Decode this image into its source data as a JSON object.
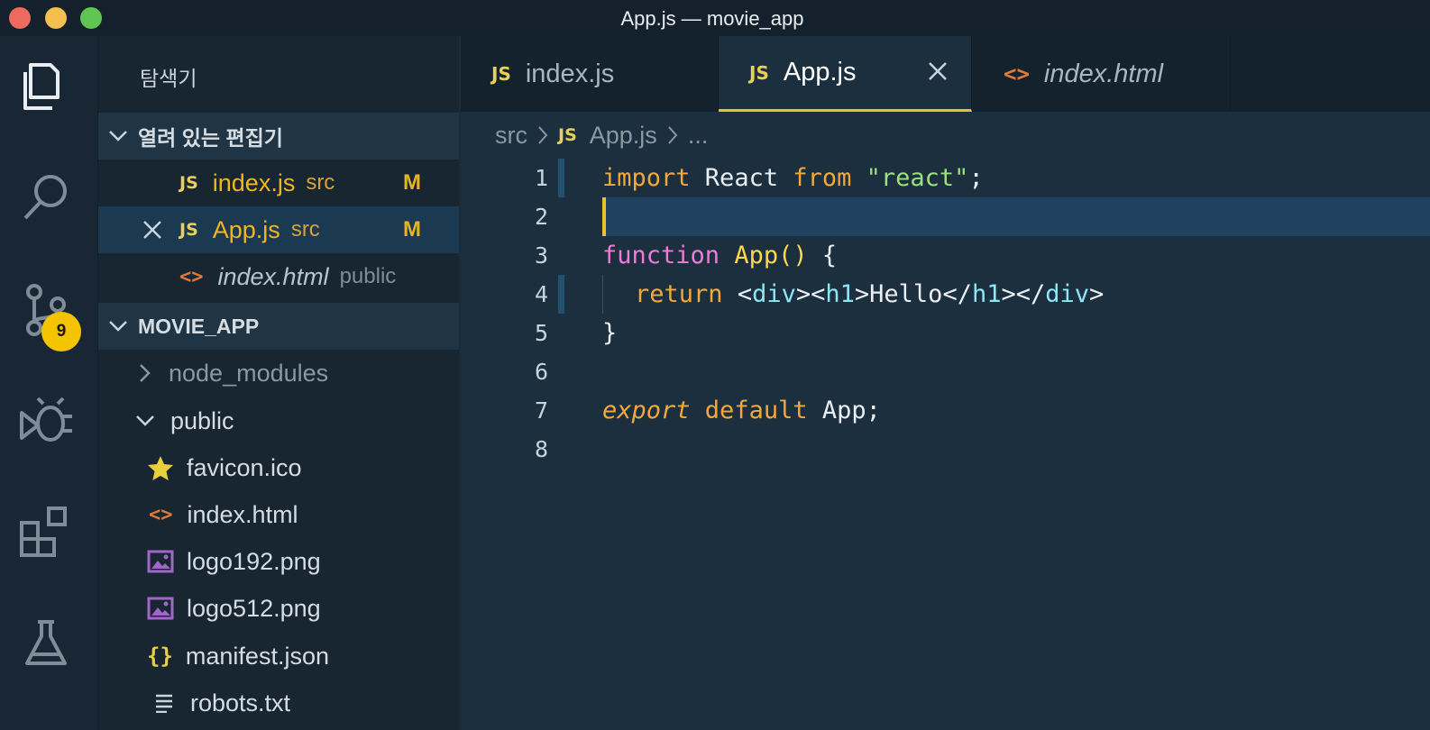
{
  "window": {
    "title": "App.js — movie_app"
  },
  "activity_bar": {
    "items": [
      {
        "icon": "files-icon"
      },
      {
        "icon": "search-icon"
      },
      {
        "icon": "source-control-icon",
        "badge": "9"
      },
      {
        "icon": "debug-icon"
      },
      {
        "icon": "extensions-icon"
      },
      {
        "icon": "testing-icon"
      }
    ]
  },
  "sidebar": {
    "title": "탐색기",
    "open_editors": {
      "header": "열려 있는 편집기",
      "items": [
        {
          "name": "index.js",
          "hint": "src",
          "status": "M"
        },
        {
          "name": "App.js",
          "hint": "src",
          "status": "M"
        },
        {
          "name": "index.html",
          "hint": "public"
        }
      ]
    },
    "project": {
      "header": "MOVIE_APP",
      "items": [
        {
          "name": "node_modules"
        },
        {
          "name": "public"
        },
        {
          "name": "favicon.ico"
        },
        {
          "name": "index.html"
        },
        {
          "name": "logo192.png"
        },
        {
          "name": "logo512.png"
        },
        {
          "name": "manifest.json"
        },
        {
          "name": "robots.txt"
        }
      ]
    }
  },
  "tabs": [
    {
      "label": "index.js",
      "icon": "JS"
    },
    {
      "label": "App.js",
      "icon": "JS"
    },
    {
      "label": "index.html",
      "icon": "<>"
    }
  ],
  "breadcrumb": {
    "folder": "src",
    "file": "App.js",
    "more": "..."
  },
  "code": {
    "line_numbers": [
      "1",
      "2",
      "3",
      "4",
      "5",
      "6",
      "7",
      "8"
    ],
    "l1": {
      "kw1": "import",
      "id": " React ",
      "kw2": "from",
      "sp": " ",
      "str": "\"react\"",
      "end": ";"
    },
    "l3": {
      "kw": "function",
      "sp": " ",
      "name": "App",
      "paren": "()",
      "brace": " {"
    },
    "l4": {
      "kw": "return",
      "sp": " ",
      "lt1": "<",
      "div1": "div",
      "gt1": "><",
      "h1a": "h1",
      "gt2": ">",
      "text": "Hello",
      "lt2": "</",
      "h1b": "h1",
      "gt3": "></",
      "div2": "div",
      "gt4": ">"
    },
    "l5": {
      "brace": "}"
    },
    "l7": {
      "kw1": "export",
      "kw2": " default",
      "rest": " App;"
    }
  },
  "colors": {
    "accent": "#e6c22d",
    "badge": "#f5c400",
    "modified": "#e6b422"
  }
}
